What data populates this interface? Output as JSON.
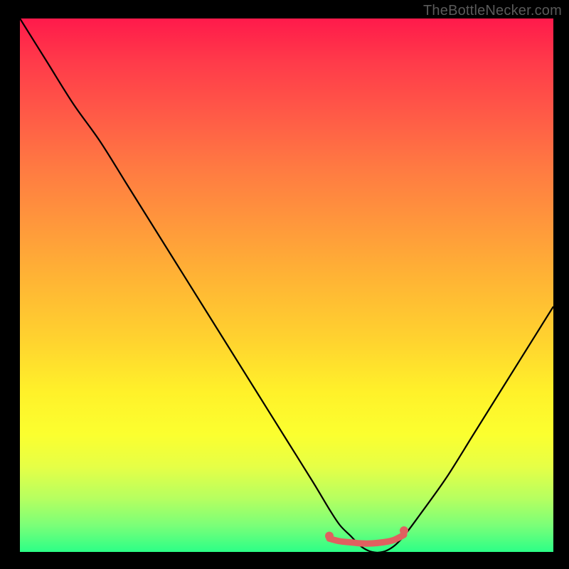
{
  "watermark": "TheBottleNecker.com",
  "chart_data": {
    "type": "line",
    "title": "",
    "xlabel": "",
    "ylabel": "",
    "xlim": [
      0,
      100
    ],
    "ylim": [
      0,
      100
    ],
    "grid": false,
    "legend": false,
    "series": [
      {
        "name": "bottleneck-curve",
        "color": "#000000",
        "x": [
          0,
          5,
          10,
          15,
          20,
          25,
          30,
          35,
          40,
          45,
          50,
          55,
          58,
          60,
          62,
          64,
          66,
          68,
          70,
          72,
          75,
          80,
          85,
          90,
          95,
          100
        ],
        "values": [
          100,
          92,
          84,
          77,
          69,
          61,
          53,
          45,
          37,
          29,
          21,
          13,
          8,
          5,
          3,
          1,
          0,
          0,
          1,
          3,
          7,
          14,
          22,
          30,
          38,
          46
        ]
      },
      {
        "name": "flat-bottom-highlight",
        "color": "#e06060",
        "x": [
          58,
          60,
          62,
          64,
          66,
          68,
          70,
          72
        ],
        "values": [
          2.5,
          2,
          1.8,
          1.6,
          1.6,
          1.8,
          2.2,
          3.2
        ]
      }
    ],
    "annotations": [
      {
        "type": "dot",
        "x": 58,
        "y": 3,
        "color": "#e06060"
      },
      {
        "type": "dot",
        "x": 72,
        "y": 4,
        "color": "#e06060"
      }
    ],
    "background": {
      "type": "vertical-gradient",
      "stops": [
        {
          "pos": 0.0,
          "color": "#ff1a4b"
        },
        {
          "pos": 0.5,
          "color": "#ffd22f"
        },
        {
          "pos": 0.8,
          "color": "#fbff2f"
        },
        {
          "pos": 1.0,
          "color": "#2cff87"
        }
      ]
    }
  }
}
